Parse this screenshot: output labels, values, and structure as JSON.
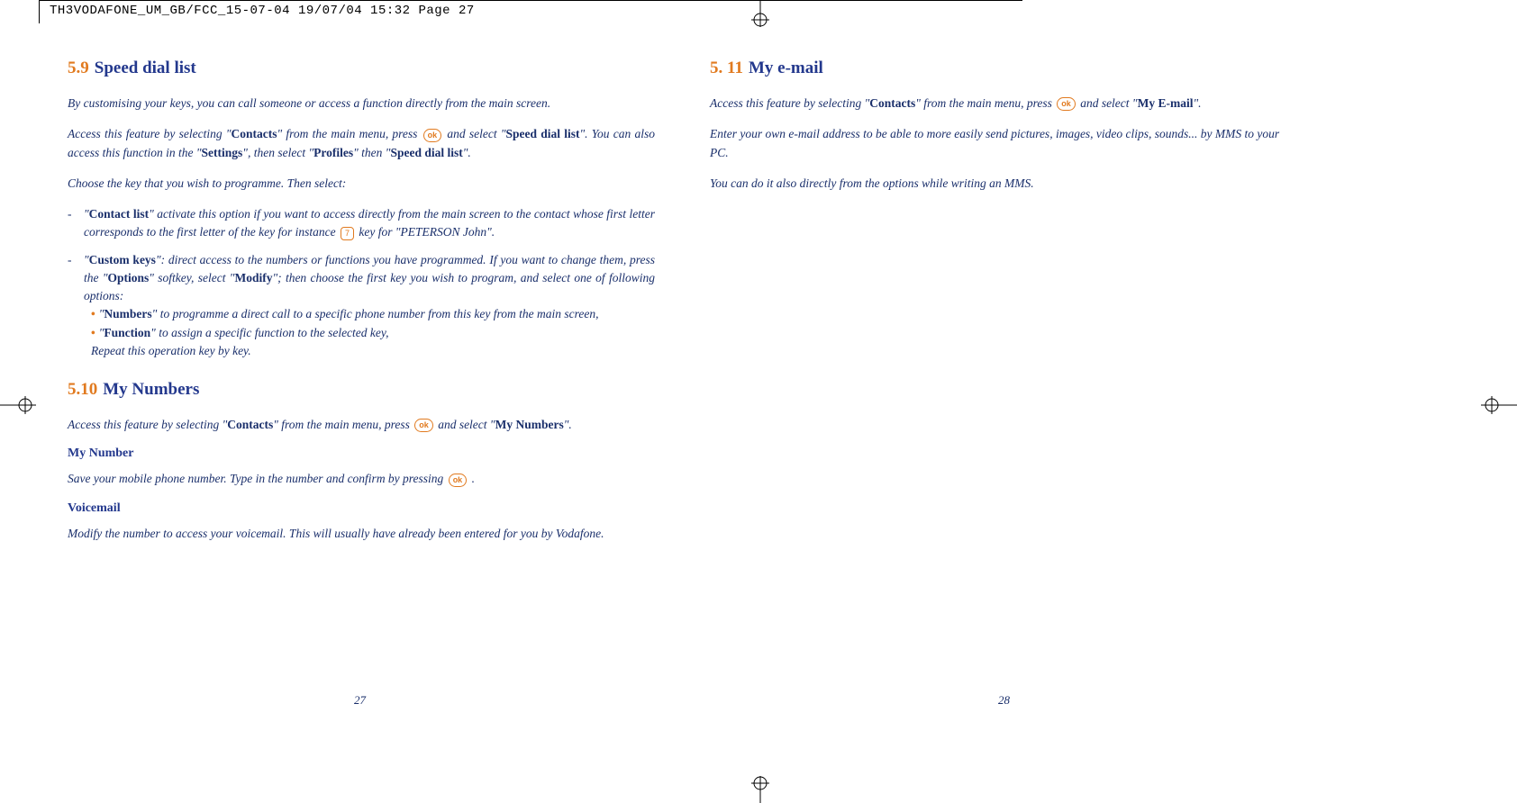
{
  "header": {
    "text": "TH3VODAFONE_UM_GB/FCC_15-07-04  19/07/04  15:32  Page 27"
  },
  "left": {
    "s59": {
      "num": "5.9",
      "title": "Speed dial list",
      "p1": "By customising your keys, you can call someone or access a function directly from the main screen.",
      "p2a": "Access this feature by selecting \"",
      "p2b": "Contacts",
      "p2c": "\" from the main menu, press ",
      "p2d": " and select \"",
      "p2e": "Speed dial list",
      "p2f": "\". You can also access this function in the \"",
      "p2g": "Settings",
      "p2h": "\", then select \"",
      "p2i": "Profiles",
      "p2j": "\" then \"",
      "p2k": "Speed dial list",
      "p2l": "\".",
      "p3": "Choose the key that you wish to programme. Then select:",
      "b1a": "\"",
      "b1b": "Contact list",
      "b1c": "\" activate this option if you want to access directly from the main screen to the contact whose first letter corresponds to the first letter of the key for instance ",
      "b1d": " key for \"PETERSON John\".",
      "b2a": "\"",
      "b2b": "Custom keys",
      "b2c": "\": direct access to the numbers or functions you have programmed. If you want to change them, press the \"",
      "b2d": "Options",
      "b2e": "\" softkey, select \"",
      "b2f": "Modify",
      "b2g": "\"; then choose the first key you wish to program, and select one of following options:",
      "sb1a": "\"",
      "sb1b": "Numbers",
      "sb1c": "\" to programme a direct call to a specific phone number from this key from the main screen,",
      "sb2a": "\"",
      "sb2b": "Function",
      "sb2c": "\" to assign a specific function to the selected key,",
      "sb3": "Repeat this operation key by key."
    },
    "s510": {
      "num": "5.10",
      "title": "My Numbers",
      "p1a": "Access this feature by selecting \"",
      "p1b": "Contacts",
      "p1c": "\" from the main menu, press ",
      "p1d": " and select \"",
      "p1e": "My Numbers",
      "p1f": "\".",
      "h1": "My Number",
      "p2a": "Save your mobile phone number. Type in the number and confirm by pressing ",
      "p2b": " .",
      "h2": "Voicemail",
      "p3": "Modify the number to access your voicemail. This will usually have already been entered for you by Vodafone."
    },
    "pagenum": "27"
  },
  "right": {
    "s511": {
      "num": "5. 11",
      "title": "My e-mail",
      "p1a": "Access this feature by selecting \"",
      "p1b": "Contacts",
      "p1c": "\" from the main menu, press ",
      "p1d": " and select \"",
      "p1e": "My E-mail",
      "p1f": "\".",
      "p2": "Enter your own e-mail address to be able to more easily send pictures, images, video clips, sounds... by MMS to your PC.",
      "p3": "You can do it also directly from the options while writing an MMS."
    },
    "pagenum": "28"
  },
  "keys": {
    "ok": "ok",
    "seven": "7"
  }
}
